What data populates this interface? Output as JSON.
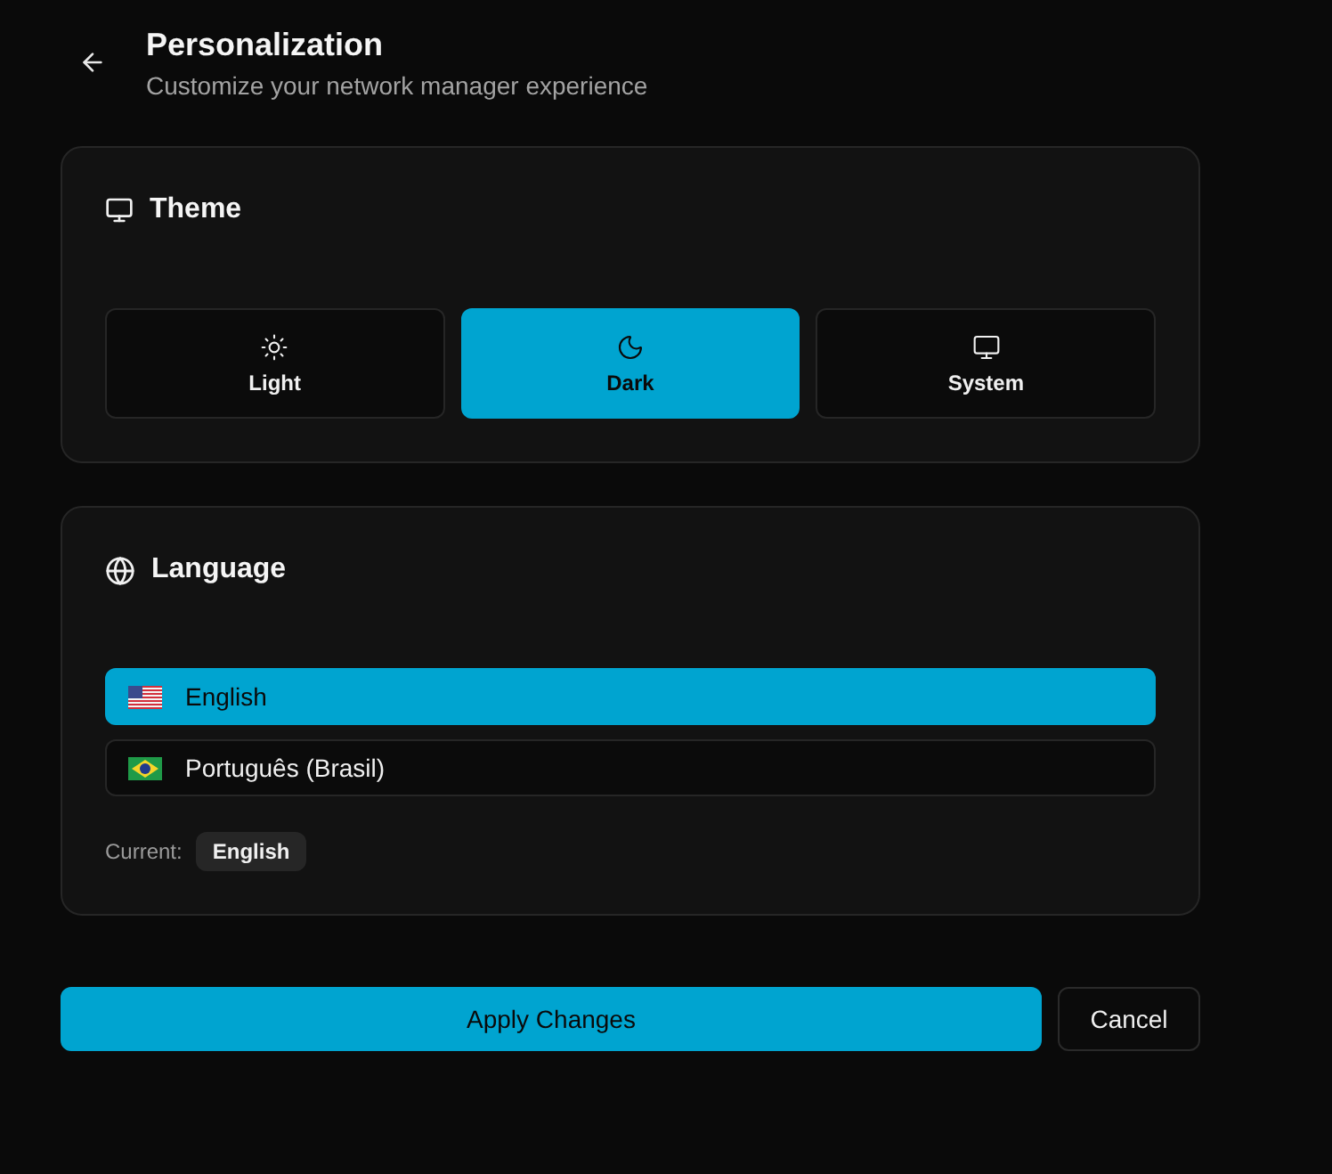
{
  "header": {
    "title": "Personalization",
    "subtitle": "Customize your network manager experience"
  },
  "theme": {
    "title": "Theme",
    "options": [
      {
        "kind": "light",
        "label": "Light",
        "selected": false
      },
      {
        "kind": "dark",
        "label": "Dark",
        "selected": true
      },
      {
        "kind": "system",
        "label": "System",
        "selected": false
      }
    ]
  },
  "language": {
    "title": "Language",
    "options": [
      {
        "kind": "us",
        "label": "English",
        "selected": true
      },
      {
        "kind": "br",
        "label": "Português (Brasil)",
        "selected": false
      }
    ],
    "current_label": "Current:",
    "current_value": "English"
  },
  "buttons": [
    {
      "kind": "primary",
      "label": "Apply Changes"
    },
    {
      "kind": "secondary",
      "label": "Cancel"
    }
  ]
}
